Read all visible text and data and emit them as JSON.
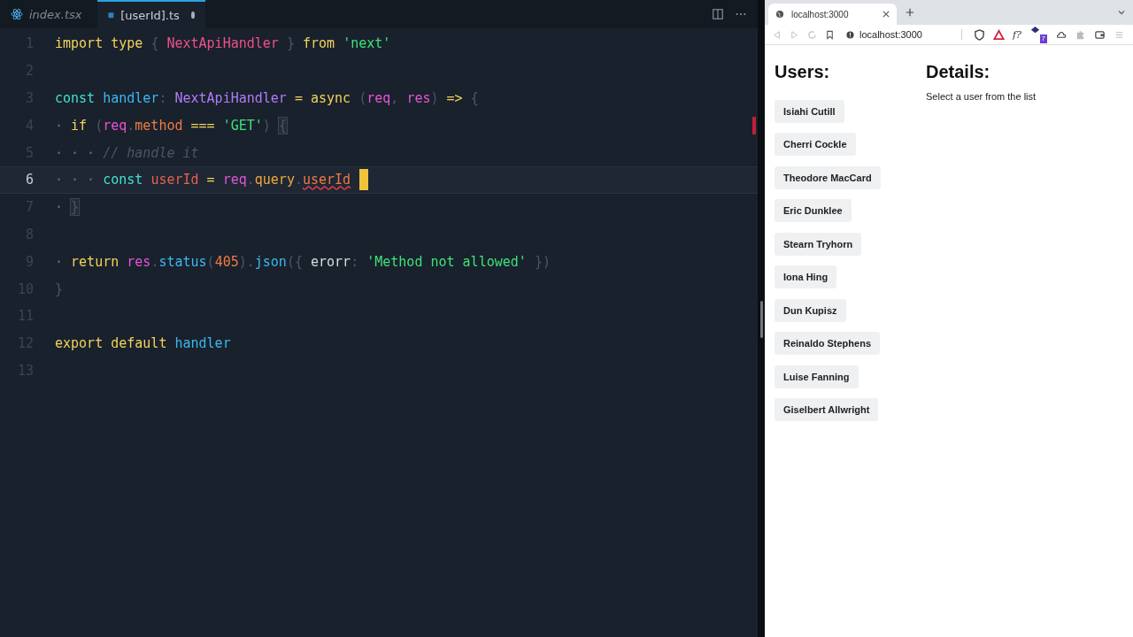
{
  "editor": {
    "tabs": [
      {
        "label": "index.tsx",
        "kind": "react",
        "selected": false,
        "modified": false
      },
      {
        "label": "[userId].ts",
        "kind": "ts",
        "selected": true,
        "modified": true
      }
    ],
    "lines": [
      {
        "number": "1",
        "current": false,
        "tokens": [
          {
            "t": "import ",
            "kind": "kw"
          },
          {
            "t": "type ",
            "kind": "kw"
          },
          {
            "t": "{ ",
            "kind": "p"
          },
          {
            "t": "NextApiHandler ",
            "kind": "type"
          },
          {
            "t": "} ",
            "kind": "p"
          },
          {
            "t": "from ",
            "kind": "kw"
          },
          {
            "t": "'next'",
            "kind": "str"
          }
        ]
      },
      {
        "number": "2",
        "current": false
      },
      {
        "number": "3",
        "current": false,
        "tokens": [
          {
            "t": "const ",
            "kind": "decl"
          },
          {
            "t": "handler",
            "kind": "fn"
          },
          {
            "t": ": ",
            "kind": "p"
          },
          {
            "t": "NextApiHandler ",
            "kind": "iface"
          },
          {
            "t": "= ",
            "kind": "kw"
          },
          {
            "t": "async ",
            "kind": "kw"
          },
          {
            "t": "(",
            "kind": "p"
          },
          {
            "t": "req",
            "kind": "param"
          },
          {
            "t": ", ",
            "kind": "p"
          },
          {
            "t": "res",
            "kind": "param"
          },
          {
            "t": ") ",
            "kind": "p"
          },
          {
            "t": "=> ",
            "kind": "kw"
          },
          {
            "t": "{",
            "kind": "p"
          }
        ]
      },
      {
        "number": "4",
        "current": false,
        "tokens": [
          {
            "t": "· ",
            "kind": "ws"
          },
          {
            "t": "if ",
            "kind": "kw"
          },
          {
            "t": "(",
            "kind": "p"
          },
          {
            "t": "req",
            "kind": "param"
          },
          {
            "t": ".",
            "kind": "p"
          },
          {
            "t": "method ",
            "kind": "prop"
          },
          {
            "t": "=== ",
            "kind": "kw"
          },
          {
            "t": "'GET'",
            "kind": "str"
          },
          {
            "t": ") ",
            "kind": "p"
          },
          {
            "t": "{",
            "kind": "p",
            "matched": true
          }
        ]
      },
      {
        "number": "5",
        "current": false,
        "tokens": [
          {
            "t": "· · · ",
            "kind": "ws"
          },
          {
            "t": "// handle it",
            "kind": "comment"
          }
        ]
      },
      {
        "number": "6",
        "current": true,
        "cursor": true,
        "tokens": [
          {
            "t": "· · · ",
            "kind": "ws"
          },
          {
            "t": "const ",
            "kind": "decl"
          },
          {
            "t": "userId ",
            "kind": "var"
          },
          {
            "t": "= ",
            "kind": "kw"
          },
          {
            "t": "req",
            "kind": "param"
          },
          {
            "t": ".",
            "kind": "p"
          },
          {
            "t": "query",
            "kind": "prop2"
          },
          {
            "t": ".",
            "kind": "p"
          },
          {
            "t": "userId",
            "kind": "prop",
            "error": true
          }
        ]
      },
      {
        "number": "7",
        "current": false,
        "tokens": [
          {
            "t": "· ",
            "kind": "ws"
          },
          {
            "t": "}",
            "kind": "p",
            "matched": true
          }
        ]
      },
      {
        "number": "8",
        "current": false
      },
      {
        "number": "9",
        "current": false,
        "tokens": [
          {
            "t": "· ",
            "kind": "ws"
          },
          {
            "t": "return ",
            "kind": "kw"
          },
          {
            "t": "res",
            "kind": "param"
          },
          {
            "t": ".",
            "kind": "p"
          },
          {
            "t": "status",
            "kind": "fn"
          },
          {
            "t": "(",
            "kind": "p"
          },
          {
            "t": "405",
            "kind": "num"
          },
          {
            "t": ")",
            "kind": "p"
          },
          {
            "t": ".",
            "kind": "p"
          },
          {
            "t": "json",
            "kind": "fn"
          },
          {
            "t": "({ ",
            "kind": "p"
          },
          {
            "t": "erorr",
            "kind": "plain"
          },
          {
            "t": ": ",
            "kind": "p"
          },
          {
            "t": "'Method not allowed' ",
            "kind": "str"
          },
          {
            "t": "})",
            "kind": "p"
          }
        ]
      },
      {
        "number": "10",
        "current": false,
        "tokens": [
          {
            "t": "}",
            "kind": "p"
          }
        ]
      },
      {
        "number": "11",
        "current": false
      },
      {
        "number": "12",
        "current": false,
        "tokens": [
          {
            "t": "export ",
            "kind": "kw"
          },
          {
            "t": "default ",
            "kind": "kw"
          },
          {
            "t": "handler",
            "kind": "fn"
          }
        ]
      },
      {
        "number": "13",
        "current": false
      }
    ]
  },
  "browser": {
    "tab_title": "localhost:3000",
    "address": "localhost:3000",
    "function_extension": "f?",
    "extension_badge": "7",
    "page": {
      "users_heading": "Users:",
      "users": [
        "Isiahi Cutill",
        "Cherri Cockle",
        "Theodore MacCard",
        "Eric Dunklee",
        "Stearn Tryhorn",
        "Iona Hing",
        "Dun Kupisz",
        "Reinaldo Stephens",
        "Luise Fanning",
        "Giselbert Allwright"
      ],
      "details_heading": "Details:",
      "details_text": "Select a user from the list"
    }
  }
}
